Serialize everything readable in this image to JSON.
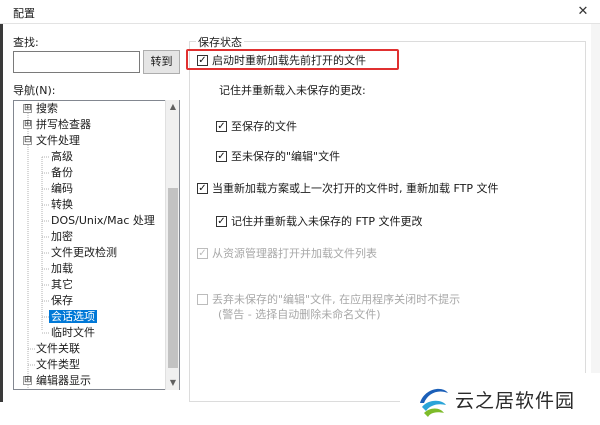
{
  "window": {
    "title": "配置",
    "close_glyph": "✕"
  },
  "find": {
    "label": "查找:",
    "value": "",
    "button": "转到"
  },
  "nav": {
    "label": "导航(N):",
    "items": [
      {
        "label": "搜索",
        "expander": "⊞"
      },
      {
        "label": "拼写检查器",
        "expander": "⊞"
      },
      {
        "label": "文件处理",
        "expander": "⊟"
      },
      {
        "label": "高级"
      },
      {
        "label": "备份"
      },
      {
        "label": "编码"
      },
      {
        "label": "转换"
      },
      {
        "label": "DOS/Unix/Mac 处理"
      },
      {
        "label": "加密"
      },
      {
        "label": "文件更改检测"
      },
      {
        "label": "加载"
      },
      {
        "label": "其它"
      },
      {
        "label": "保存"
      },
      {
        "label": "会话选项",
        "selected": true
      },
      {
        "label": "临时文件"
      },
      {
        "label": "文件关联"
      },
      {
        "label": "文件类型"
      },
      {
        "label": "编辑器显示",
        "expander": "⊞"
      }
    ]
  },
  "panel": {
    "group_title": "保存状态",
    "options": {
      "reload_last_files": {
        "label": "启动时重新加载先前打开的文件",
        "checked": true
      },
      "remember_unsaved_caption": "记住并重新载入未保存的更改:",
      "to_saved_files": {
        "label": "至保存的文件",
        "checked": true
      },
      "to_unsaved_edit_files": {
        "label": "至未保存的\"编辑\"文件",
        "checked": true
      },
      "reload_ftp": {
        "label": "当重新加载方案或上一次打开的文件时, 重新加载 FTP 文件",
        "checked": true
      },
      "remember_ftp_changes": {
        "label": "记住并重新载入未保存的 FTP 文件更改",
        "checked": true
      },
      "load_from_explorer": {
        "label": "从资源管理器打开并加载文件列表",
        "checked": true,
        "disabled": true
      },
      "discard_unsaved": {
        "label": "丢弃未保存的\"编辑\"文件, 在应用程序关闭时不提示",
        "note": "(警告 - 选择自动删除未命名文件)",
        "checked": false,
        "disabled": true
      }
    }
  },
  "watermark": {
    "text": "云之居软件园"
  },
  "colors": {
    "selection": "#0078d7",
    "highlight_border": "#e03030"
  }
}
